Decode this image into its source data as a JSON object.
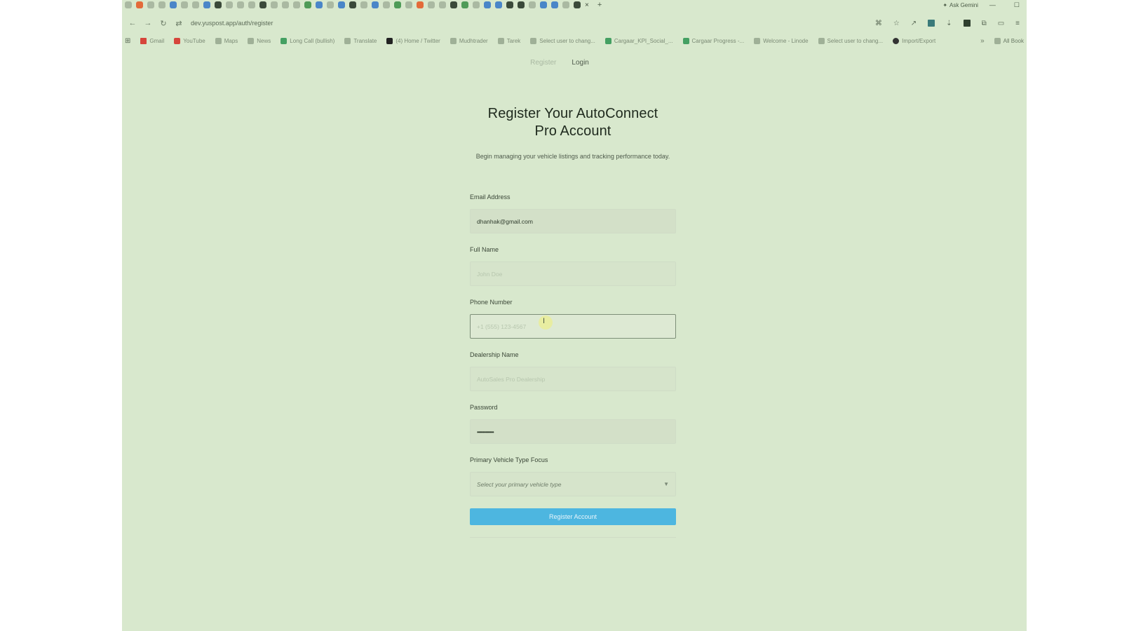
{
  "browser": {
    "tab_close": "×",
    "tab_new": "+",
    "ask_gemini": "Ask Gemini",
    "url": "dev.yuspost.app/auth/register",
    "bookmarks": [
      {
        "label": "Gmail",
        "icon": "gmail-icon"
      },
      {
        "label": "YouTube",
        "icon": "youtube-icon"
      },
      {
        "label": "Maps",
        "icon": "maps-icon"
      },
      {
        "label": "News",
        "icon": "news-icon"
      },
      {
        "label": "Long Call (bullish)",
        "icon": "chart-icon"
      },
      {
        "label": "Translate",
        "icon": "translate-icon"
      },
      {
        "label": "(4) Home / Twitter",
        "icon": "x-icon"
      },
      {
        "label": "Mudhtrader",
        "icon": "globe-icon"
      },
      {
        "label": "Tarek",
        "icon": "folder-icon"
      },
      {
        "label": "Select user to chang...",
        "icon": "globe-icon"
      },
      {
        "label": "Cargaar_KPI_Social_...",
        "icon": "sheets-icon"
      },
      {
        "label": "Cargaar Progress -...",
        "icon": "sheets-icon"
      },
      {
        "label": "Welcome - Linode",
        "icon": "linode-icon"
      },
      {
        "label": "Select user to chang...",
        "icon": "globe-icon"
      },
      {
        "label": "Import/Export",
        "icon": "github-icon"
      }
    ],
    "bookmarks_more": "»",
    "all_bookmarks": "All Book"
  },
  "nav": {
    "register": "Register",
    "login": "Login"
  },
  "form": {
    "title_line1": "Register Your AutoConnect",
    "title_line2": "Pro Account",
    "subtitle": "Begin managing your vehicle listings and tracking performance today.",
    "email": {
      "label": "Email Address",
      "value": "dhanhak@gmail.com"
    },
    "full_name": {
      "label": "Full Name",
      "placeholder": "John Doe"
    },
    "phone": {
      "label": "Phone Number",
      "placeholder": "+1 (555) 123-4567"
    },
    "dealership": {
      "label": "Dealership Name",
      "placeholder": "AutoSales Pro Dealership"
    },
    "password": {
      "label": "Password",
      "value": "••••••••••••"
    },
    "vehicle_type": {
      "label": "Primary Vehicle Type Focus",
      "selected": "Select your primary vehicle type"
    },
    "submit": "Register Account"
  },
  "colors": {
    "background": "#d8e8cd",
    "accent": "#4db6e0"
  }
}
